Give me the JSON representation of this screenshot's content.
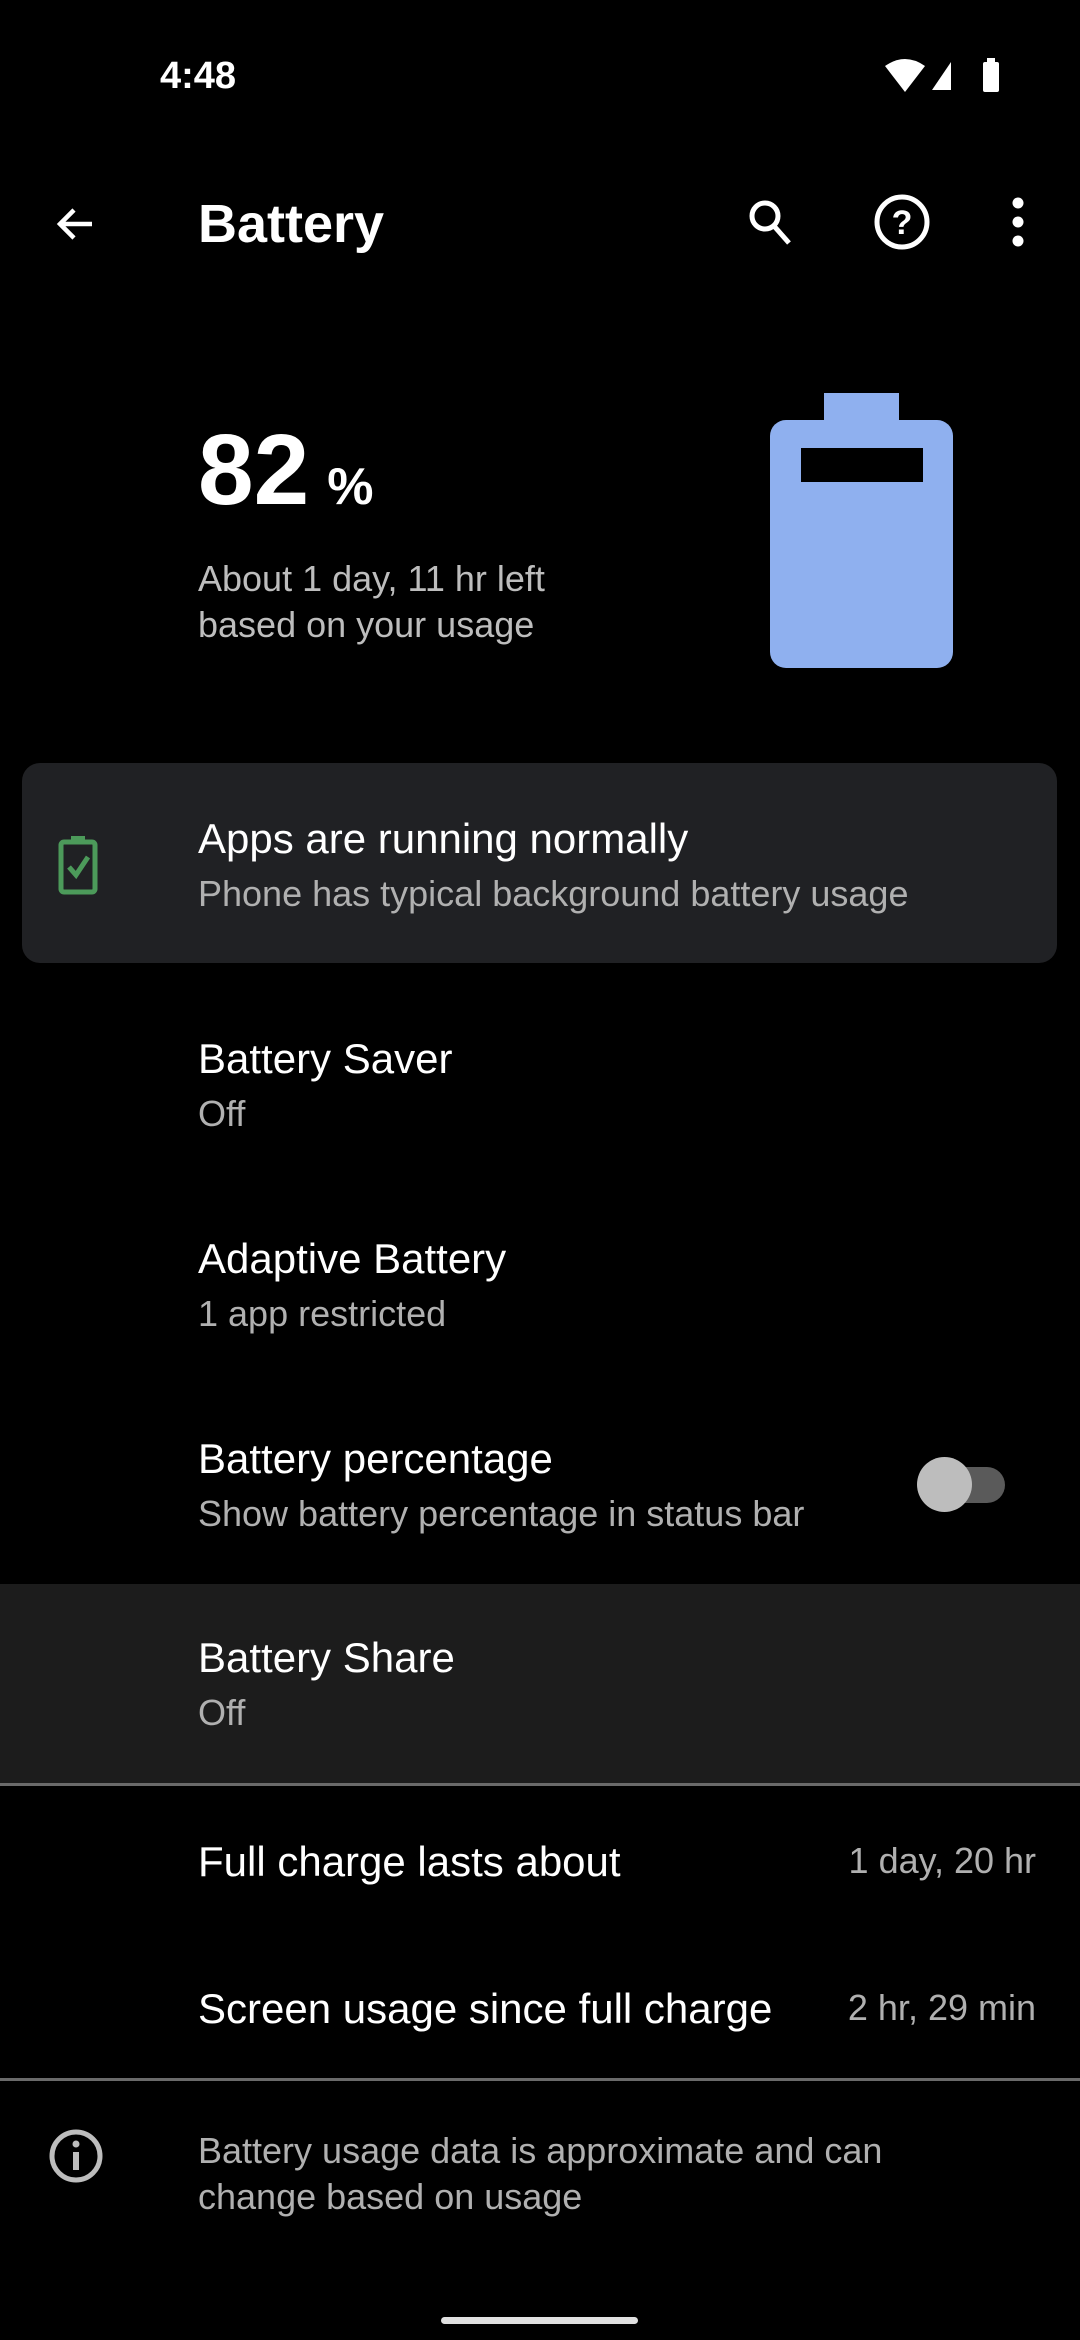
{
  "status_bar": {
    "time": "4:48",
    "icons": [
      "wifi-icon",
      "cell-signal-icon",
      "battery-icon"
    ]
  },
  "app_bar": {
    "title": "Battery",
    "back": "arrow-back-icon",
    "actions": [
      "search-icon",
      "help-icon",
      "more-vert-icon"
    ]
  },
  "summary": {
    "level": "82",
    "unit": "%",
    "level_fraction": 0.82,
    "estimate_line1": "About 1 day, 11 hr left",
    "estimate_line2": "based on your usage",
    "battery_color": "#8fb0ef"
  },
  "tip_card": {
    "title": "Apps are running normally",
    "subtitle": "Phone has typical background battery usage",
    "icon_color": "#4c9a5a"
  },
  "settings": [
    {
      "title": "Battery Saver",
      "summary": "Off"
    },
    {
      "title": "Adaptive Battery",
      "summary": "1 app restricted"
    },
    {
      "title": "Battery percentage",
      "summary": "Show battery percentage in status bar",
      "toggle": false
    },
    {
      "title": "Battery Share",
      "summary": "Off"
    }
  ],
  "stats": [
    {
      "label": "Full charge lasts about",
      "value": "1 day, 20 hr"
    },
    {
      "label": "Screen usage since full charge",
      "value": "2 hr, 29 min"
    }
  ],
  "footer": {
    "text_line1": "Battery usage data is approximate and can",
    "text_line2": "change based on usage"
  }
}
